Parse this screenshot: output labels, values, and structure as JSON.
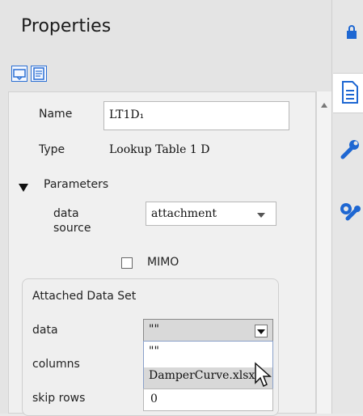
{
  "panel": {
    "title": "Properties",
    "fields": {
      "name_label": "Name",
      "name_value": "LT1D₁",
      "type_label": "Type",
      "type_value": "Lookup Table 1 D"
    },
    "parameters": {
      "header": "Parameters",
      "data_source_label_1": "data",
      "data_source_label_2": "source",
      "data_source_value": "attachment",
      "mimo_label": "MIMO"
    },
    "attached": {
      "title": "Attached Data Set",
      "data_label": "data",
      "data_value": "\"\"",
      "columns_label": "columns",
      "skip_rows_label": "skip rows",
      "skip_rows_value": "0"
    },
    "dropdown_options": [
      "\"\"",
      "DamperCurve.xlsx"
    ]
  },
  "icons": [
    "lock-icon",
    "document-icon",
    "wrench-icon",
    "gear-wrench-icon"
  ]
}
